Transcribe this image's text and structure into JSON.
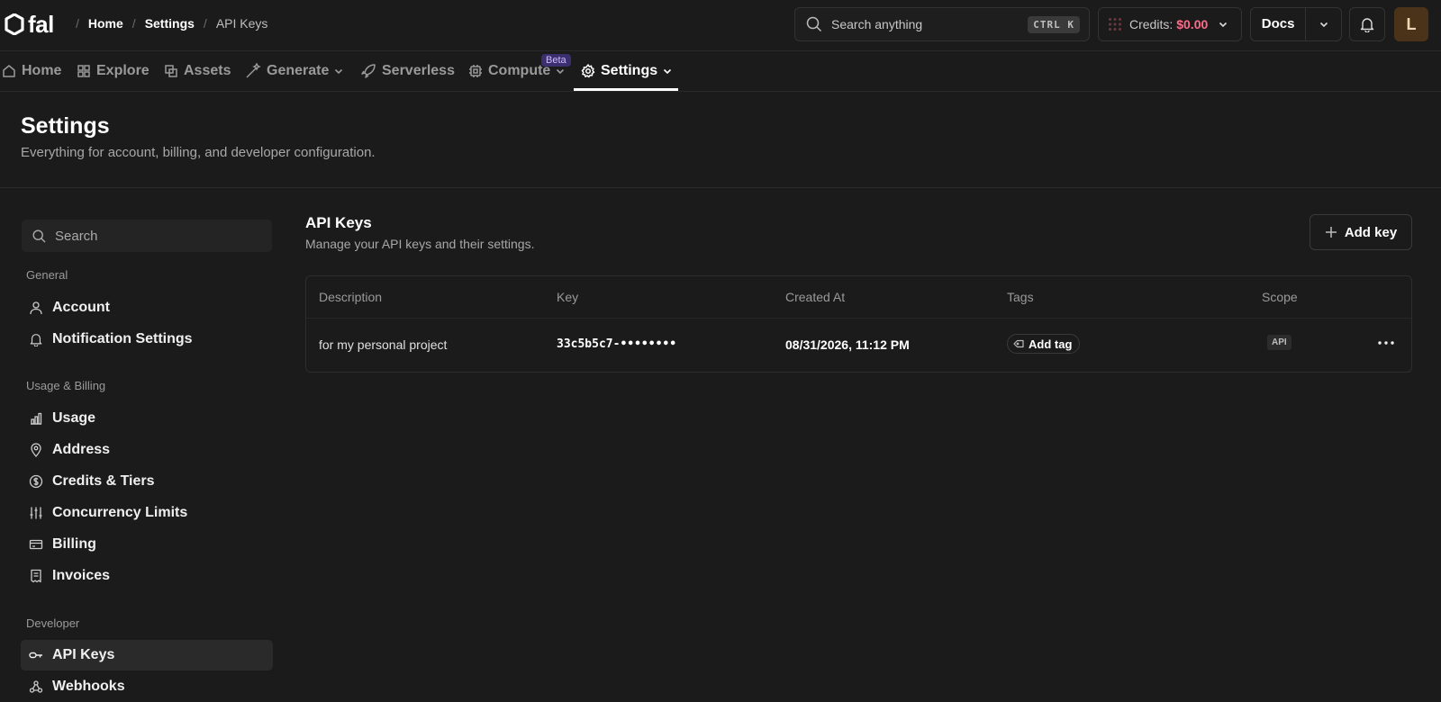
{
  "brand": {
    "name": "fal"
  },
  "breadcrumb": [
    "Home",
    "Settings",
    "API Keys"
  ],
  "search": {
    "placeholder": "Search anything",
    "shortcut": "CTRL K"
  },
  "credits": {
    "label": "Credits:",
    "value": "$0.00",
    "value_color": "#ff6b8a"
  },
  "docs": {
    "label": "Docs"
  },
  "user": {
    "avatar_initial": "L"
  },
  "nav": {
    "items": [
      {
        "label": "Home",
        "icon": "home-icon"
      },
      {
        "label": "Explore",
        "icon": "grid-icon"
      },
      {
        "label": "Assets",
        "icon": "assets-icon"
      },
      {
        "label": "Generate",
        "icon": "wand-icon"
      },
      {
        "label": "Serverless",
        "icon": "rocket-icon"
      },
      {
        "label": "Compute",
        "icon": "chip-icon"
      },
      {
        "label": "Settings",
        "icon": "gear-icon"
      }
    ],
    "beta_badge": "Beta",
    "active": "Settings"
  },
  "page": {
    "title": "Settings",
    "subtitle": "Everything for account, billing, and developer configuration."
  },
  "sidebar": {
    "search_placeholder": "Search",
    "groups": [
      {
        "label": "General",
        "items": [
          "Account",
          "Notification Settings"
        ]
      },
      {
        "label": "Usage & Billing",
        "items": [
          "Usage",
          "Address",
          "Credits & Tiers",
          "Concurrency Limits",
          "Billing",
          "Invoices"
        ]
      },
      {
        "label": "Developer",
        "items": [
          "API Keys",
          "Webhooks"
        ]
      }
    ],
    "active_item": "API Keys"
  },
  "main": {
    "title": "API Keys",
    "subtitle": "Manage your API keys and their settings.",
    "add_button": "Add key",
    "table": {
      "columns": [
        "Description",
        "Key",
        "Created At",
        "Tags",
        "Scope"
      ],
      "rows": [
        {
          "description": "for my personal project",
          "key": "33c5b5c7-••••••••",
          "created_at": "08/31/2026, 11:12 PM",
          "tag_button": "Add tag",
          "scope": "API"
        }
      ]
    }
  }
}
